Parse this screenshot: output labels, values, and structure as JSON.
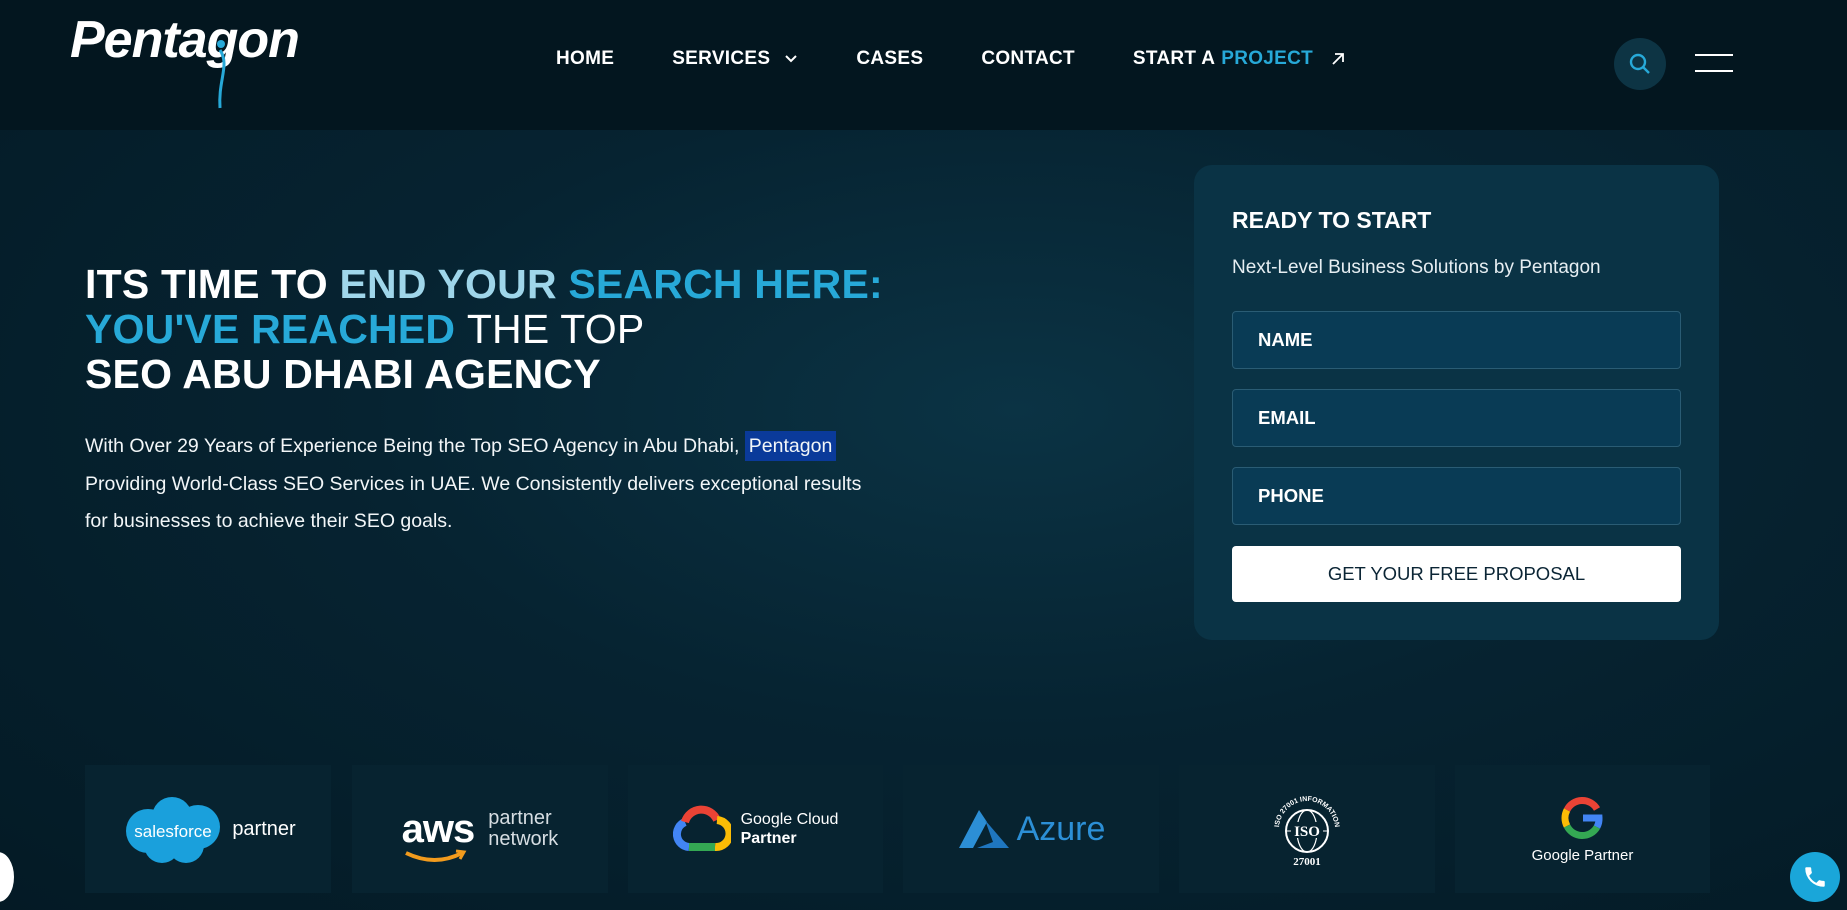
{
  "brand": {
    "name": "Pentagon"
  },
  "nav": {
    "items": [
      {
        "label": "HOME"
      },
      {
        "label": "SERVICES"
      },
      {
        "label": "CASES"
      },
      {
        "label": "CONTACT"
      }
    ],
    "project_prefix": "START A",
    "project_accent": "PROJECT"
  },
  "hero": {
    "title_part1": "ITS TIME TO",
    "title_part2": "END YOUR",
    "title_part3": "SEARCH HERE: YOU'VE REACHED",
    "title_part4": "THE TOP",
    "title_part5": "SEO ABU DHABI AGENCY",
    "desc_before": "With Over 29 Years of Experience Being the Top SEO Agency in Abu Dhabi,",
    "desc_highlight": "Pentagon",
    "desc_after": "Providing World-Class SEO Services in UAE. We Consistently delivers exceptional results for businesses to achieve their SEO goals."
  },
  "form": {
    "title": "READY TO START",
    "subtitle": "Next-Level Business Solutions by Pentagon",
    "name_placeholder": "NAME",
    "email_placeholder": "EMAIL",
    "phone_placeholder": "PHONE",
    "submit_label": "GET YOUR FREE PROPOSAL"
  },
  "partners": {
    "salesforce_logo": "salesforce",
    "salesforce_label": "partner",
    "aws_logo": "aws",
    "aws_line1": "partner",
    "aws_line2": "network",
    "gcloud_line1": "Google Cloud",
    "gcloud_line2": "Partner",
    "azure_label": "Azure",
    "iso_ring": "ISO 27001 INFORMATION SECURITY",
    "iso_label": "ISO",
    "iso_number": "27001",
    "google_label": "Google Partner"
  },
  "colors": {
    "accent": "#27a9d8",
    "accent_light": "#9fd6ea",
    "background": "#041a25",
    "card": "#0a3345"
  }
}
